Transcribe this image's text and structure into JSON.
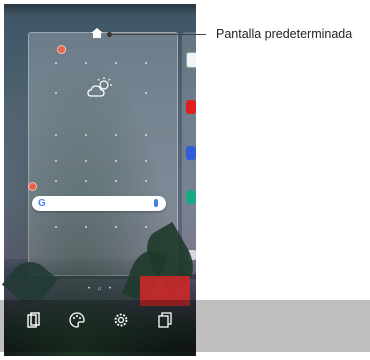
{
  "callout": {
    "label": "Pantalla predeterminada"
  },
  "search_bar": {
    "logo": "G"
  },
  "icons": {
    "home": "home-icon",
    "weather": "partly-cloudy-weather-icon",
    "search": "google-g-icon",
    "mic": "microphone-icon",
    "toolbar": [
      "widgets-icon",
      "wallpaper-palette-icon",
      "settings-gear-icon",
      "copy-page-icon"
    ]
  },
  "colors": {
    "remove_badge": "#e8644e",
    "google_blue": "#4285f4"
  }
}
